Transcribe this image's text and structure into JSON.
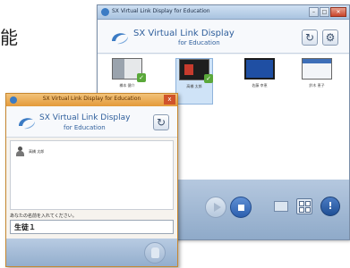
{
  "edge_text": "能",
  "back_window": {
    "title": "SX Virtual Link Display for Education",
    "brand_line1": "SX Virtual Link Display",
    "brand_line2": "for Education",
    "thumbnails": [
      {
        "name": "橋本 健介",
        "selected": false,
        "checked": true
      },
      {
        "name": "高橋 太郎",
        "selected": true,
        "checked": true
      },
      {
        "name": "佐藤 幸恵",
        "selected": false,
        "checked": false
      },
      {
        "name": "鈴木 恵子",
        "selected": false,
        "checked": false
      }
    ],
    "controls": {
      "refresh_icon": "refresh-icon",
      "settings_icon": "gear-icon",
      "play_icon": "play-icon",
      "stop_icon": "stop-icon",
      "wide_icon": "wide-screen-icon",
      "grid_icon": "grid-icon",
      "info_icon": "info-icon",
      "info_glyph": "!"
    },
    "colors": {
      "accent": "#2c5fae",
      "footer": "#9fb6d3"
    }
  },
  "front_window": {
    "title": "SX Virtual Link Display for Education",
    "close_glyph": "x",
    "brand_line1": "SX Virtual Link Display",
    "brand_line2": "for Education",
    "user_item": "高橋 太郎",
    "prompt": "あなたの名前を入れてください。",
    "name_value": "生徒１",
    "colors": {
      "titlebar": "#e39a3a"
    }
  }
}
